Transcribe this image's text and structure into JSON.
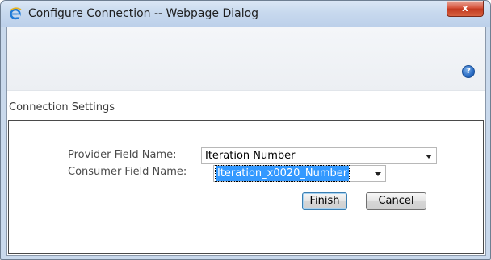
{
  "window": {
    "title": "Configure Connection -- Webpage Dialog",
    "close_label": "x"
  },
  "toolbar": {
    "help_label": "?"
  },
  "section": {
    "title": "Connection Settings"
  },
  "form": {
    "provider_label": "Provider Field Name:",
    "provider_value": "Iteration Number",
    "consumer_label": "Consumer Field Name:",
    "consumer_value": "Iteration_x0020_Number"
  },
  "buttons": {
    "finish": "Finish",
    "cancel": "Cancel"
  },
  "colors": {
    "selection": "#3399ff",
    "help_icon": "#2a6cc4",
    "close_button": "#c9482c"
  }
}
